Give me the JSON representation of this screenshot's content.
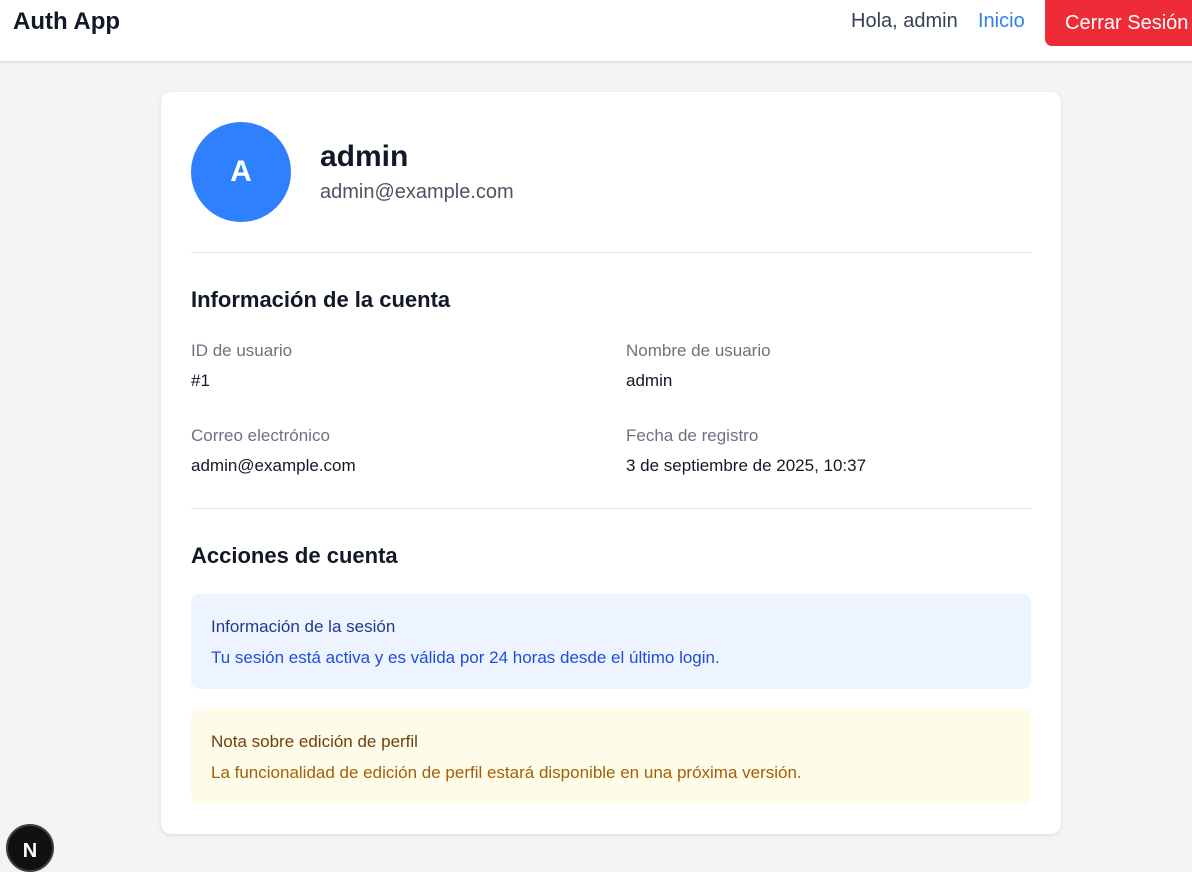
{
  "header": {
    "brand": "Auth App",
    "greeting": "Hola, admin",
    "home_link": "Inicio",
    "logout_button": "Cerrar Sesión"
  },
  "profile": {
    "avatar_initial": "A",
    "name": "admin",
    "email": "admin@example.com"
  },
  "account_info": {
    "title": "Información de la cuenta",
    "fields": [
      {
        "label": "ID de usuario",
        "value": "#1"
      },
      {
        "label": "Nombre de usuario",
        "value": "admin"
      },
      {
        "label": "Correo electrónico",
        "value": "admin@example.com"
      },
      {
        "label": "Fecha de registro",
        "value": "3 de septiembre de 2025, 10:37"
      }
    ]
  },
  "account_actions": {
    "title": "Acciones de cuenta",
    "session_notice": {
      "title": "Información de la sesión",
      "text": "Tu sesión está activa y es válida por 24 horas desde el último login."
    },
    "edit_notice": {
      "title": "Nota sobre edición de perfil",
      "text": "La funcionalidad de edición de perfil estará disponible en una próxima versión."
    }
  },
  "dev_badge": {
    "label": "N"
  },
  "colors": {
    "accent": "#2f80ff",
    "link": "#2f80ed",
    "danger": "#ef2b37"
  }
}
